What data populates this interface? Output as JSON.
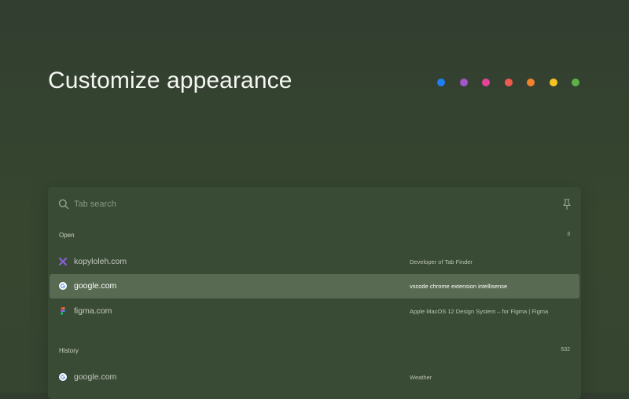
{
  "headline": "Customize appearance",
  "theme_colors": [
    {
      "name": "blue",
      "hex": "#1d7ff0"
    },
    {
      "name": "purple",
      "hex": "#a355c9"
    },
    {
      "name": "pink",
      "hex": "#e4439a"
    },
    {
      "name": "red",
      "hex": "#ef5a4e"
    },
    {
      "name": "orange",
      "hex": "#f0832c"
    },
    {
      "name": "yellow",
      "hex": "#f6c523"
    },
    {
      "name": "green",
      "hex": "#5cb146"
    }
  ],
  "search": {
    "placeholder": "Tab search",
    "value": ""
  },
  "sections": {
    "open": {
      "title": "Open",
      "count": "3",
      "rows": [
        {
          "domain": "kopyloleh.com",
          "title": "Developer of Tab Finder",
          "icon": "kopyloleh-favicon",
          "selected": false
        },
        {
          "domain": "google.com",
          "title": "vscode chrome extension intellisense",
          "icon": "google-favicon",
          "selected": true
        },
        {
          "domain": "figma.com",
          "title": "Apple MacOS 12 Design System – for Figma | Figma",
          "icon": "figma-favicon",
          "selected": false
        }
      ]
    },
    "history": {
      "title": "History",
      "count": "532",
      "rows": [
        {
          "domain": "google.com",
          "title": "Weather",
          "icon": "google-favicon",
          "selected": false
        }
      ]
    }
  }
}
